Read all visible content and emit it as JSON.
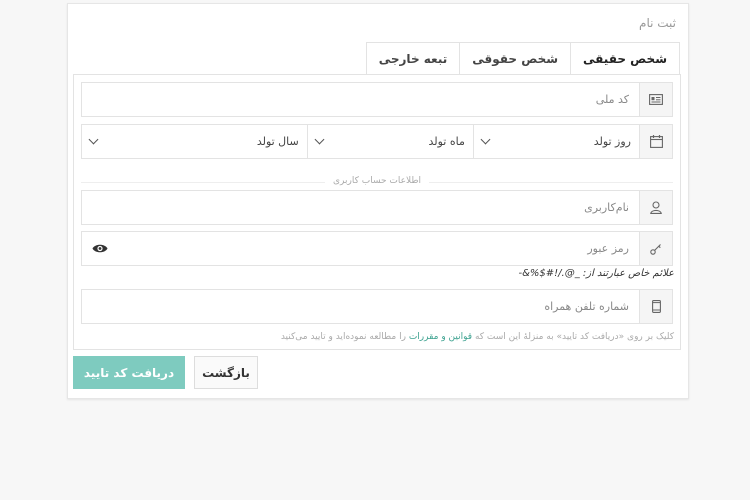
{
  "card": {
    "title": "ثبت نام"
  },
  "tabs": [
    {
      "label": "شخص حقیقی",
      "active": true
    },
    {
      "label": "شخص حقوقی",
      "active": false
    },
    {
      "label": "تبعه خارجی",
      "active": false
    }
  ],
  "form": {
    "national_code": {
      "placeholder": "کد ملی",
      "icon": "id-card-icon"
    },
    "birth": {
      "icon": "calendar-icon",
      "day": "روز تولد",
      "month": "ماه تولد",
      "year": "سال تولد"
    },
    "section_divider": "اطلاعات حساب کاربری",
    "username": {
      "placeholder": "نام‌کاربری",
      "icon": "user-icon"
    },
    "password": {
      "placeholder": "رمز عبور",
      "icon": "key-icon",
      "toggle_icon": "eye-icon"
    },
    "password_hint": "علائم خاص عبارتند از: _@./!#$%&-",
    "mobile": {
      "placeholder": "شماره تلفن همراه",
      "icon": "mobile-icon"
    },
    "terms": {
      "before": "کلیک بر روی «دریافت کد تایید» به منزلهٔ این است که ",
      "link": "قوانین و مقررات",
      "after": " را مطالعه نموده‌اید و تایید می‌کنید"
    }
  },
  "buttons": {
    "submit": "دریافت کد تایید",
    "back": "بازگشت"
  },
  "colors": {
    "primary": "#7ecbbf",
    "link": "#3fa391"
  }
}
